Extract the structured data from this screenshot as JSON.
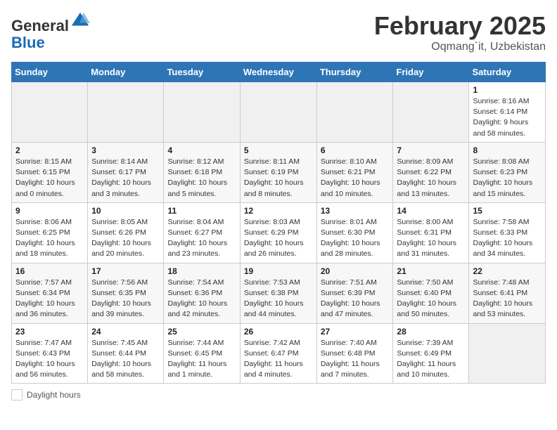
{
  "header": {
    "logo_line1": "General",
    "logo_line2": "Blue",
    "title": "February 2025",
    "location": "Oqmang`it, Uzbekistan"
  },
  "legend": {
    "label": "Daylight hours"
  },
  "days_of_week": [
    "Sunday",
    "Monday",
    "Tuesday",
    "Wednesday",
    "Thursday",
    "Friday",
    "Saturday"
  ],
  "weeks": [
    [
      {
        "num": "",
        "info": ""
      },
      {
        "num": "",
        "info": ""
      },
      {
        "num": "",
        "info": ""
      },
      {
        "num": "",
        "info": ""
      },
      {
        "num": "",
        "info": ""
      },
      {
        "num": "",
        "info": ""
      },
      {
        "num": "1",
        "info": "Sunrise: 8:16 AM\nSunset: 6:14 PM\nDaylight: 9 hours\nand 58 minutes."
      }
    ],
    [
      {
        "num": "2",
        "info": "Sunrise: 8:15 AM\nSunset: 6:15 PM\nDaylight: 10 hours\nand 0 minutes."
      },
      {
        "num": "3",
        "info": "Sunrise: 8:14 AM\nSunset: 6:17 PM\nDaylight: 10 hours\nand 3 minutes."
      },
      {
        "num": "4",
        "info": "Sunrise: 8:12 AM\nSunset: 6:18 PM\nDaylight: 10 hours\nand 5 minutes."
      },
      {
        "num": "5",
        "info": "Sunrise: 8:11 AM\nSunset: 6:19 PM\nDaylight: 10 hours\nand 8 minutes."
      },
      {
        "num": "6",
        "info": "Sunrise: 8:10 AM\nSunset: 6:21 PM\nDaylight: 10 hours\nand 10 minutes."
      },
      {
        "num": "7",
        "info": "Sunrise: 8:09 AM\nSunset: 6:22 PM\nDaylight: 10 hours\nand 13 minutes."
      },
      {
        "num": "8",
        "info": "Sunrise: 8:08 AM\nSunset: 6:23 PM\nDaylight: 10 hours\nand 15 minutes."
      }
    ],
    [
      {
        "num": "9",
        "info": "Sunrise: 8:06 AM\nSunset: 6:25 PM\nDaylight: 10 hours\nand 18 minutes."
      },
      {
        "num": "10",
        "info": "Sunrise: 8:05 AM\nSunset: 6:26 PM\nDaylight: 10 hours\nand 20 minutes."
      },
      {
        "num": "11",
        "info": "Sunrise: 8:04 AM\nSunset: 6:27 PM\nDaylight: 10 hours\nand 23 minutes."
      },
      {
        "num": "12",
        "info": "Sunrise: 8:03 AM\nSunset: 6:29 PM\nDaylight: 10 hours\nand 26 minutes."
      },
      {
        "num": "13",
        "info": "Sunrise: 8:01 AM\nSunset: 6:30 PM\nDaylight: 10 hours\nand 28 minutes."
      },
      {
        "num": "14",
        "info": "Sunrise: 8:00 AM\nSunset: 6:31 PM\nDaylight: 10 hours\nand 31 minutes."
      },
      {
        "num": "15",
        "info": "Sunrise: 7:58 AM\nSunset: 6:33 PM\nDaylight: 10 hours\nand 34 minutes."
      }
    ],
    [
      {
        "num": "16",
        "info": "Sunrise: 7:57 AM\nSunset: 6:34 PM\nDaylight: 10 hours\nand 36 minutes."
      },
      {
        "num": "17",
        "info": "Sunrise: 7:56 AM\nSunset: 6:35 PM\nDaylight: 10 hours\nand 39 minutes."
      },
      {
        "num": "18",
        "info": "Sunrise: 7:54 AM\nSunset: 6:36 PM\nDaylight: 10 hours\nand 42 minutes."
      },
      {
        "num": "19",
        "info": "Sunrise: 7:53 AM\nSunset: 6:38 PM\nDaylight: 10 hours\nand 44 minutes."
      },
      {
        "num": "20",
        "info": "Sunrise: 7:51 AM\nSunset: 6:39 PM\nDaylight: 10 hours\nand 47 minutes."
      },
      {
        "num": "21",
        "info": "Sunrise: 7:50 AM\nSunset: 6:40 PM\nDaylight: 10 hours\nand 50 minutes."
      },
      {
        "num": "22",
        "info": "Sunrise: 7:48 AM\nSunset: 6:41 PM\nDaylight: 10 hours\nand 53 minutes."
      }
    ],
    [
      {
        "num": "23",
        "info": "Sunrise: 7:47 AM\nSunset: 6:43 PM\nDaylight: 10 hours\nand 56 minutes."
      },
      {
        "num": "24",
        "info": "Sunrise: 7:45 AM\nSunset: 6:44 PM\nDaylight: 10 hours\nand 58 minutes."
      },
      {
        "num": "25",
        "info": "Sunrise: 7:44 AM\nSunset: 6:45 PM\nDaylight: 11 hours\nand 1 minute."
      },
      {
        "num": "26",
        "info": "Sunrise: 7:42 AM\nSunset: 6:47 PM\nDaylight: 11 hours\nand 4 minutes."
      },
      {
        "num": "27",
        "info": "Sunrise: 7:40 AM\nSunset: 6:48 PM\nDaylight: 11 hours\nand 7 minutes."
      },
      {
        "num": "28",
        "info": "Sunrise: 7:39 AM\nSunset: 6:49 PM\nDaylight: 11 hours\nand 10 minutes."
      },
      {
        "num": "",
        "info": ""
      }
    ]
  ]
}
